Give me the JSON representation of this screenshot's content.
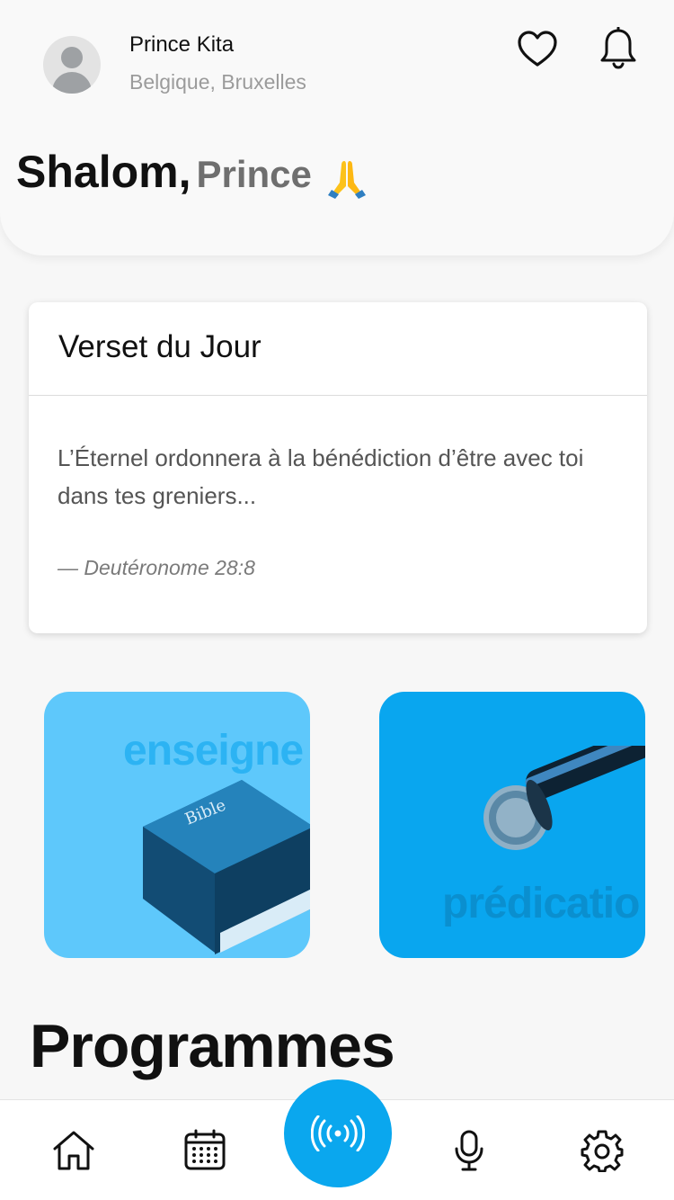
{
  "user": {
    "name": "Prince Kita",
    "location": "Belgique, Bruxelles"
  },
  "greeting": {
    "hello": "Shalom,",
    "name": "Prince"
  },
  "verse": {
    "title": "Verset du Jour",
    "text": "L’Éternel ordonnera à la bénédiction d’être avec toi dans tes greniers...",
    "reference": "— Deutéronome 28:8"
  },
  "tiles": [
    {
      "word": "enseigne",
      "icon": "bible-book-icon"
    },
    {
      "word": "prédicatio",
      "icon": "microphone-icon"
    }
  ],
  "section": {
    "title": "Programmes"
  },
  "nav": {
    "items": [
      "home-icon",
      "calendar-icon",
      "live-broadcast-icon",
      "microphone-icon",
      "gear-icon"
    ]
  },
  "colors": {
    "accent": "#0aa7ee",
    "tile_light": "#5ec8fb",
    "tile_dark": "#09a6ef"
  }
}
